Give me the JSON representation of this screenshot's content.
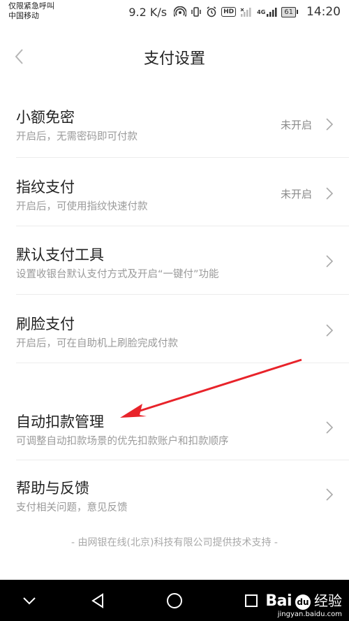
{
  "status_bar": {
    "carrier_line1": "仅限紧急呼叫",
    "carrier_line2": "中国移动",
    "speed": "9.2 K/s",
    "hd": "HD",
    "network": "4G",
    "battery": "61",
    "time": "14:20"
  },
  "header": {
    "title": "支付设置"
  },
  "settings": [
    {
      "title": "小额免密",
      "subtitle": "开启后，无需密码即可付款",
      "status": "未开启"
    },
    {
      "title": "指纹支付",
      "subtitle": "开启后，可使用指纹快速付款",
      "status": "未开启"
    },
    {
      "title": "默认支付工具",
      "subtitle": "设置收银台默认支付方式及开启“一键付”功能",
      "status": ""
    },
    {
      "title": "刷脸支付",
      "subtitle": "开启后，可在自助机上刷脸完成付款",
      "status": ""
    },
    {
      "title": "自动扣款管理",
      "subtitle": "可调整自动扣款场景的优先扣款账户和扣款顺序",
      "status": ""
    },
    {
      "title": "帮助与反馈",
      "subtitle": "支付相关问题，意见反馈",
      "status": ""
    }
  ],
  "footer_note": "- 由网银在线(北京)科技有限公司提供技术支持 -",
  "annotation_color": "#e8232a",
  "watermark": {
    "logo": "Bai",
    "paw": "du",
    "text": "经验",
    "sub": "jingyan.baidu.com"
  }
}
